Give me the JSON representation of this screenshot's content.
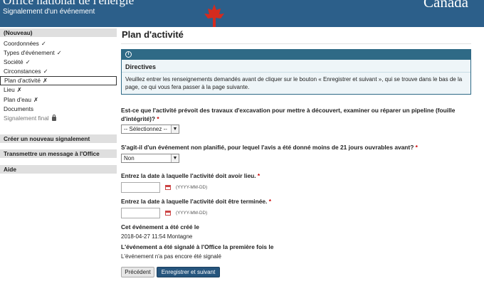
{
  "header": {
    "org_name": "Office national de l'énergie",
    "subtitle": "Signalement d'un événement",
    "canada": "Canada"
  },
  "sidebar": {
    "heading": "(Nouveau)",
    "items": [
      {
        "label": "Coordonnées",
        "mark": "✓"
      },
      {
        "label": "Types d'événement",
        "mark": "✓"
      },
      {
        "label": "Société",
        "mark": "✓"
      },
      {
        "label": "Circonstances",
        "mark": "✓"
      },
      {
        "label": "Plan d'activité",
        "mark": "✗"
      },
      {
        "label": "Lieu",
        "mark": "✗"
      },
      {
        "label": "Plan d'eau",
        "mark": "✗"
      },
      {
        "label": "Documents",
        "mark": ""
      },
      {
        "label": "Signalement final",
        "mark": ""
      }
    ],
    "sections": [
      "Créer un nouveau signalement",
      "Transmettre un message à l'Office",
      "Aide"
    ]
  },
  "main": {
    "title": "Plan d'activité",
    "directives": {
      "heading": "Directives",
      "text": "Veuillez entrer les renseignements demandés avant de cliquer sur le bouton « Enregistrer et suivant », qui se trouve dans le bas de la page, ce qui vous fera passer à la page suivante."
    },
    "q1": {
      "label": "Est-ce que l'activité prévoit des travaux d'excavation pour mettre à découvert, examiner ou réparer un pipeline (fouille d'intégrité)?",
      "required": "*",
      "value": "-- Sélectionnez --"
    },
    "q2": {
      "label": "S'agit-il d'un événement non planifié, pour lequel l'avis a été donné moins de 21 jours ouvrables avant?",
      "required": "*",
      "value": "Non"
    },
    "q3": {
      "label": "Entrez la date à laquelle l'activité doit avoir lieu.",
      "required": "*",
      "value": "",
      "hint": "(YYYY-MM-DD)"
    },
    "q4": {
      "label": "Entrez la date à laquelle l'activité doit être terminée.",
      "required": "*",
      "value": "",
      "hint": "(YYYY-MM-DD)"
    },
    "created": {
      "label": "Cet événement a été créé le",
      "value": "2018-04-27 11:54 Montagne"
    },
    "reported": {
      "label": "L'événement a été signalé à l'Office la première fois le",
      "value": "L'événement n'a pas encore été signalé"
    },
    "buttons": {
      "previous": "Précédent",
      "next": "Enregistrer et suivant"
    }
  },
  "colors": {
    "header_bg": "#2c5f8a",
    "panel_accent": "#2f6a86",
    "primary_button": "#26557d",
    "required": "#cc0000"
  }
}
